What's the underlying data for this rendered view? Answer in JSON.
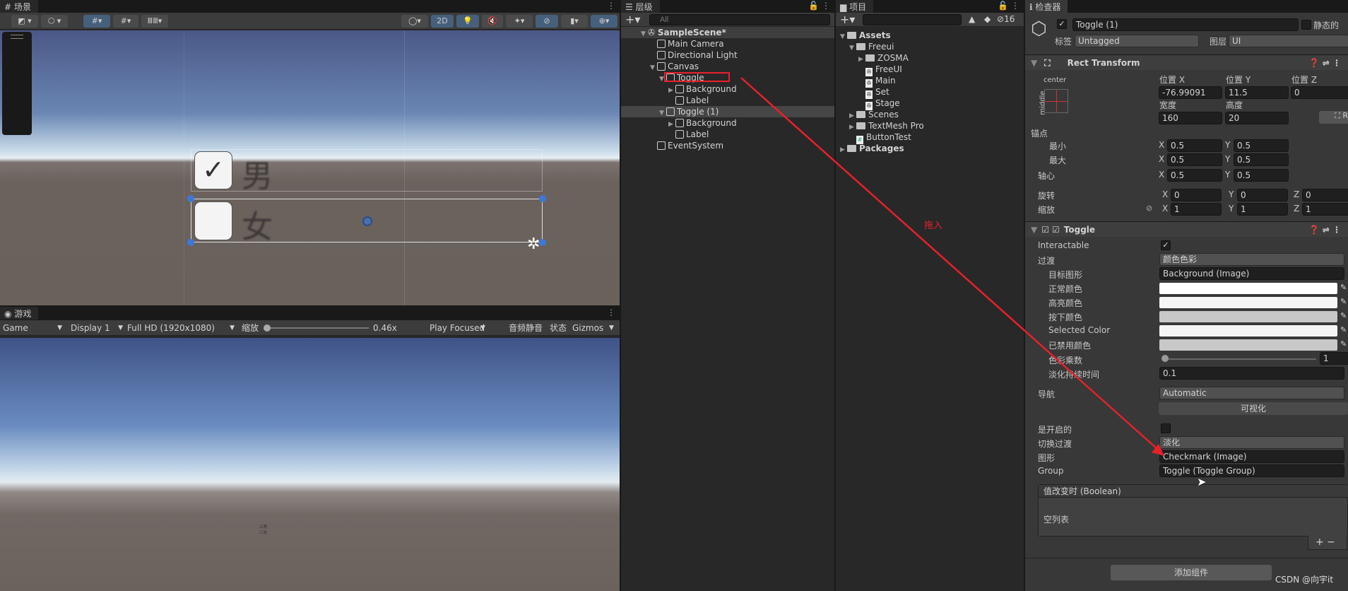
{
  "scene": {
    "tab": "场景",
    "btn_2d": "2D",
    "tools": [
      "hand-tool",
      "move-tool",
      "rotate-tool",
      "scale-tool",
      "rect-tool",
      "transform-tool"
    ],
    "toggle_labels": [
      "男",
      "女"
    ]
  },
  "game": {
    "tab": "游戏",
    "display_mode": "Game",
    "display": "Display 1",
    "resolution": "Full HD (1920x1080)",
    "scale_label": "缩放",
    "scale_value": "0.46x",
    "scale_fraction": 0.0,
    "play_mode": "Play Focused",
    "mute": "音频静音",
    "stats": "状态",
    "gizmos": "Gizmos",
    "toggle_labels": [
      "男",
      "女"
    ]
  },
  "hierarchy": {
    "tab": "层级",
    "search_placeholder": "All",
    "items": [
      {
        "label": "SampleScene*",
        "depth": 0,
        "expanded": true,
        "kind": "scene"
      },
      {
        "label": "Main Camera",
        "depth": 1,
        "kind": "go"
      },
      {
        "label": "Directional Light",
        "depth": 1,
        "kind": "go"
      },
      {
        "label": "Canvas",
        "depth": 1,
        "expanded": true,
        "kind": "go"
      },
      {
        "label": "Toggle",
        "depth": 2,
        "expanded": true,
        "kind": "go"
      },
      {
        "label": "Background",
        "depth": 3,
        "expanded": false,
        "kind": "go"
      },
      {
        "label": "Label",
        "depth": 3,
        "kind": "go"
      },
      {
        "label": "Toggle (1)",
        "depth": 2,
        "expanded": true,
        "kind": "go",
        "selected": true
      },
      {
        "label": "Background",
        "depth": 3,
        "expanded": false,
        "kind": "go"
      },
      {
        "label": "Label",
        "depth": 3,
        "kind": "go"
      },
      {
        "label": "EventSystem",
        "depth": 1,
        "kind": "go"
      }
    ]
  },
  "project": {
    "tab": "项目",
    "hidden_count": "16",
    "items": [
      {
        "label": "Assets",
        "depth": 0,
        "expanded": true,
        "kind": "folder",
        "bold": true
      },
      {
        "label": "Freeui",
        "depth": 1,
        "expanded": true,
        "kind": "folder"
      },
      {
        "label": "ZOSMA",
        "depth": 2,
        "expanded": false,
        "kind": "folder"
      },
      {
        "label": "FreeUI",
        "depth": 2,
        "kind": "scene"
      },
      {
        "label": "Main",
        "depth": 2,
        "kind": "scene"
      },
      {
        "label": "Set",
        "depth": 2,
        "kind": "scene"
      },
      {
        "label": "Stage",
        "depth": 2,
        "kind": "scene"
      },
      {
        "label": "Scenes",
        "depth": 1,
        "expanded": false,
        "kind": "folder"
      },
      {
        "label": "TextMesh Pro",
        "depth": 1,
        "expanded": false,
        "kind": "folder"
      },
      {
        "label": "ButtonTest",
        "depth": 1,
        "kind": "script"
      },
      {
        "label": "Packages",
        "depth": 0,
        "expanded": false,
        "kind": "folder",
        "bold": true
      }
    ]
  },
  "inspector": {
    "tab": "检查器",
    "name": "Toggle (1)",
    "static_label": "静态的",
    "tag_label": "标签",
    "tag": "Untagged",
    "layer_label": "图层",
    "layer": "UI",
    "rect": {
      "title": "Rect Transform",
      "anchor_h": "center",
      "anchor_v": "middle",
      "posx_l": "位置 X",
      "posy_l": "位置 Y",
      "posz_l": "位置 Z",
      "posx": "-76.99091",
      "posy": "11.5",
      "posz": "0",
      "w_l": "宽度",
      "h_l": "高度",
      "w": "160",
      "h": "20",
      "anchors_l": "锚点",
      "min_l": "最小",
      "max_l": "最大",
      "pivot_l": "轴心",
      "rot_l": "旋转",
      "scale_l": "缩放",
      "min": [
        "0.5",
        "0.5"
      ],
      "max": [
        "0.5",
        "0.5"
      ],
      "pivot": [
        "0.5",
        "0.5"
      ],
      "rot": [
        "0",
        "0",
        "0"
      ],
      "scale": [
        "1",
        "1",
        "1"
      ],
      "x": "X",
      "y": "Y",
      "z": "Z",
      "r": "R"
    },
    "toggle": {
      "title": "Toggle",
      "interactable_l": "Interactable",
      "transition_l": "过渡",
      "transition": "颜色色彩",
      "target_l": "目标图形",
      "target": "Background (Image)",
      "normal_l": "正常颜色",
      "highlight_l": "高亮颜色",
      "pressed_l": "按下颜色",
      "selected_l": "Selected Color",
      "disabled_l": "已禁用颜色",
      "colors": {
        "normal": "#ffffff",
        "highlight": "#f5f5f5",
        "pressed": "#c8c8c8",
        "selected": "#f5f5f5",
        "disabled": "#c8c8c8"
      },
      "mult_l": "色彩乘数",
      "mult": "1",
      "fade_l": "淡化持续时间",
      "fade": "0.1",
      "nav_l": "导航",
      "nav": "Automatic",
      "visualize": "可视化",
      "ison_l": "是开启的",
      "toggle_trans_l": "切换过渡",
      "toggle_trans": "淡化",
      "graphic_l": "图形",
      "graphic": "Checkmark (Image)",
      "group_l": "Group",
      "group": "Toggle (Toggle Group)",
      "event_l": "值改变时 (Boolean)",
      "empty": "空列表"
    },
    "add_component": "添加组件"
  },
  "annotation": {
    "text": "拖入",
    "color": "#e8202a"
  },
  "watermark": "CSDN @向宇it"
}
